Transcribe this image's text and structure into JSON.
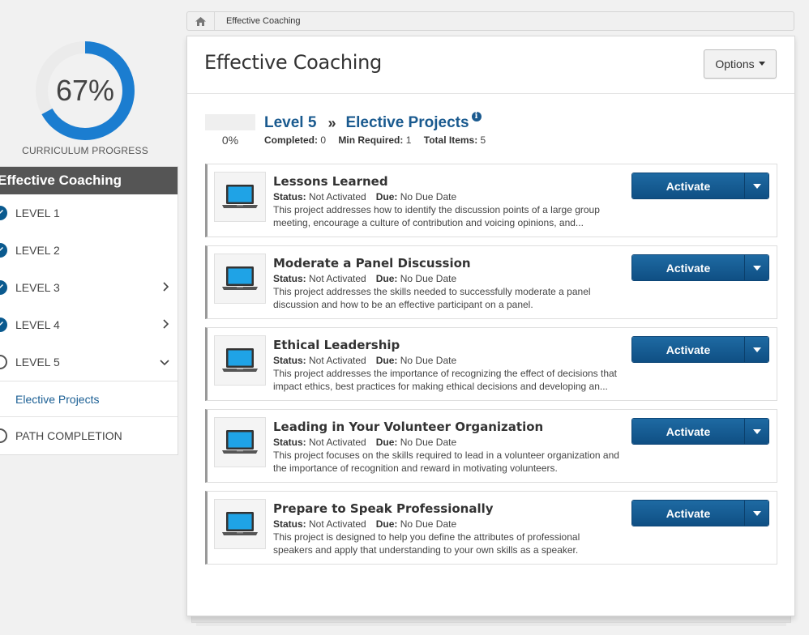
{
  "curriculum": {
    "progress_percent": 67,
    "progress_text": "67%",
    "progress_label": "CURRICULUM PROGRESS"
  },
  "sidebar": {
    "heading": "Effective Coaching",
    "items": [
      {
        "label": "LEVEL 1",
        "state": "completed",
        "expand": "none"
      },
      {
        "label": "LEVEL 2",
        "state": "completed",
        "expand": "none"
      },
      {
        "label": "LEVEL 3",
        "state": "completed",
        "expand": "chevron-right"
      },
      {
        "label": "LEVEL 4",
        "state": "completed",
        "expand": "chevron-right"
      },
      {
        "label": "LEVEL 5",
        "state": "in-progress",
        "expand": "chevron-down"
      }
    ],
    "sub_item": "Elective Projects",
    "completion_item": "PATH COMPLETION"
  },
  "breadcrumb": {
    "current": "Effective Coaching"
  },
  "panel": {
    "title": "Effective Coaching",
    "options_label": "Options"
  },
  "level": {
    "percent_text": "0%",
    "level_name": "Level 5",
    "section_name": "Elective Projects",
    "completed_label": "Completed:",
    "completed_value": "0",
    "min_required_label": "Min Required:",
    "min_required_value": "1",
    "total_items_label": "Total Items:",
    "total_items_value": "5"
  },
  "projects": [
    {
      "title": "Lessons Learned",
      "status_label": "Status:",
      "status": "Not Activated",
      "due_label": "Due:",
      "due": "No Due Date",
      "description": "This project addresses how to identify the discussion points of a large group meeting, encourage a culture of contribution and voicing opinions, and...",
      "action": "Activate"
    },
    {
      "title": "Moderate a Panel Discussion",
      "status_label": "Status:",
      "status": "Not Activated",
      "due_label": "Due:",
      "due": "No Due Date",
      "description": "This project addresses the skills needed to successfully moderate a panel discussion and how to be an effective participant on a panel.",
      "action": "Activate"
    },
    {
      "title": "Ethical Leadership",
      "status_label": "Status:",
      "status": "Not Activated",
      "due_label": "Due:",
      "due": "No Due Date",
      "description": "This project addresses the importance of recognizing the effect of decisions that impact ethics, best practices for making ethical decisions and developing an...",
      "action": "Activate"
    },
    {
      "title": "Leading in Your Volunteer Organization",
      "status_label": "Status:",
      "status": "Not Activated",
      "due_label": "Due:",
      "due": "No Due Date",
      "description": "This project focuses on the skills required to lead in a volunteer organization and the importance of recognition and reward in motivating volunteers.",
      "action": "Activate"
    },
    {
      "title": "Prepare to Speak Professionally",
      "status_label": "Status:",
      "status": "Not Activated",
      "due_label": "Due:",
      "due": "No Due Date",
      "description": "This project is designed to help you define the attributes of professional speakers and apply that understanding to your own skills as a speaker.",
      "action": "Activate"
    }
  ],
  "colors": {
    "accent": "#1b7dd0",
    "ring_track": "#ebebeb",
    "link": "#1a5a8f",
    "button": "#0f4f84",
    "sidebar_header": "#555555"
  },
  "icons": {
    "home": "home-icon",
    "completed": "checkmark-circle-icon",
    "in_progress": "empty-circle-icon",
    "info": "info-icon",
    "project_thumb": "laptop-icon"
  }
}
